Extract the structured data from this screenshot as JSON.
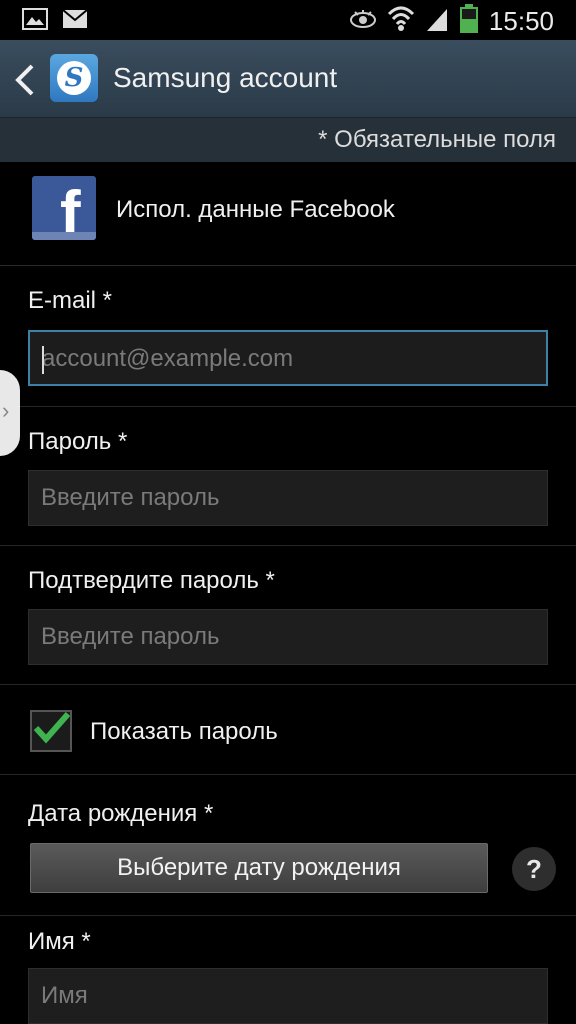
{
  "status_bar": {
    "time": "15:50",
    "icons": [
      "gallery-icon",
      "mail-icon",
      "eye-icon",
      "wifi-icon",
      "signal-icon",
      "battery-icon"
    ]
  },
  "action_bar": {
    "title": "Samsung account",
    "logo_letter": "S"
  },
  "required_note": "* Обязательные поля",
  "facebook": {
    "label": "Испол. данные Facebook",
    "logo_letter": "f"
  },
  "fields": {
    "email": {
      "label": "E-mail *",
      "placeholder": "account@example.com"
    },
    "password": {
      "label": "Пароль *",
      "placeholder": "Введите пароль"
    },
    "confirm_password": {
      "label": "Подтвердите пароль *",
      "placeholder": "Введите пароль"
    },
    "show_password": {
      "label": "Показать пароль",
      "checked": true
    },
    "birth_date": {
      "label": "Дата рождения *",
      "button": "Выберите дату рождения",
      "help": "?"
    },
    "name": {
      "label": "Имя *",
      "placeholder": "Имя"
    }
  },
  "side_tab": {
    "glyph": "›"
  },
  "colors": {
    "accent_blue": "#3f80a8",
    "checkmark_green": "#3fb34f",
    "facebook_blue": "#3b5998"
  }
}
